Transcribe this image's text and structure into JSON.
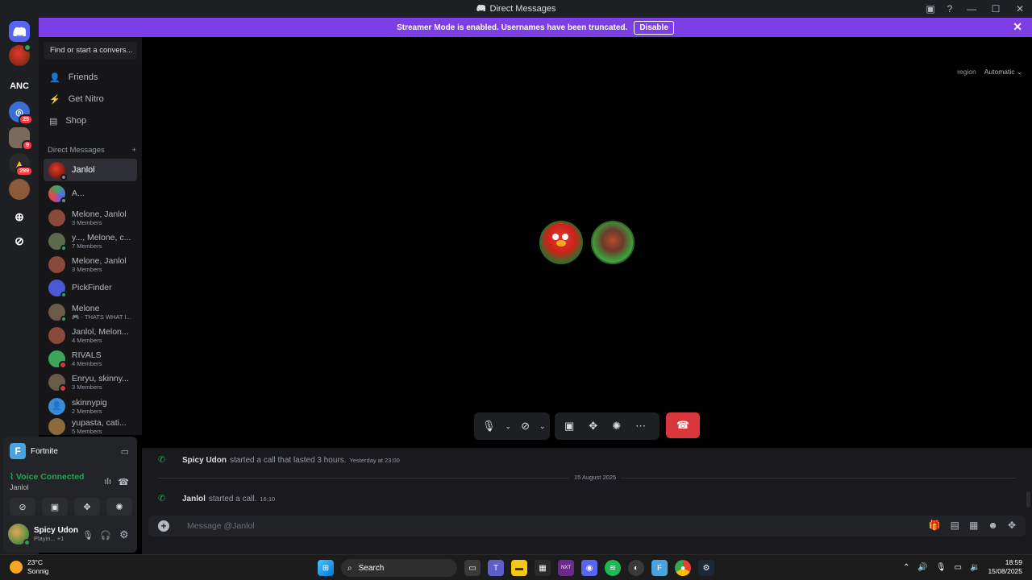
{
  "window": {
    "title": "Direct Messages"
  },
  "banner": {
    "text": "Streamer Mode is enabled. Usernames have been truncated.",
    "button": "Disable"
  },
  "servers": [
    {
      "label": "",
      "badge": ""
    },
    {
      "label": "ANC",
      "badge": ""
    },
    {
      "label": "",
      "badge": "25"
    },
    {
      "label": "",
      "badge": "9"
    },
    {
      "label": "",
      "badge": "299"
    }
  ],
  "sidebar": {
    "search_placeholder": "Find or start a convers...",
    "nav": [
      "Friends",
      "Get Nitro",
      "Shop"
    ],
    "dm_header": "Direct Messages",
    "dms": [
      {
        "name": "Janlol",
        "sub": ""
      },
      {
        "name": "A...",
        "sub": ""
      },
      {
        "name": "Melone, Janlol",
        "sub": "3 Members"
      },
      {
        "name": "y..., Melone, c...",
        "sub": "7 Members"
      },
      {
        "name": "Melone, Janlol",
        "sub": "3 Members"
      },
      {
        "name": "PickFinder",
        "sub": ""
      },
      {
        "name": "Melone",
        "sub": "🎮 - THATS WHAT I..."
      },
      {
        "name": "Janlol, Melon...",
        "sub": "4 Members"
      },
      {
        "name": "RIVALS",
        "sub": "4 Members"
      },
      {
        "name": "Enryu, skinny...",
        "sub": "3 Members"
      },
      {
        "name": "skinnypig",
        "sub": "2 Members"
      },
      {
        "name": "yupasta, cati...",
        "sub": "5 Members"
      }
    ]
  },
  "panel": {
    "game": "Fortnite",
    "voice_status": "Voice Connected",
    "channel": "Janlol",
    "user_name": "Spicy Udon",
    "user_status": "Playin...",
    "user_extra": "+1"
  },
  "call": {
    "region_label": "region",
    "region_value": "Automatic"
  },
  "chat": {
    "messages": [
      {
        "who": "Spicy Udon",
        "text": "started a call that lasted 3 hours.",
        "time": "Yesterday at 23:00"
      },
      {
        "who": "Janlol",
        "text": "started a call.",
        "time": "16:10"
      }
    ],
    "date_divider": "15 August 2025",
    "input_placeholder": "Message @Janlol"
  },
  "taskbar": {
    "temp": "23°C",
    "weather": "Sonnig",
    "search": "Search",
    "time": "18:59",
    "date": "15/08/2025"
  },
  "colors": {
    "accent": "#5865f2",
    "streamer_banner": "#7e3ee6",
    "online": "#23a55a",
    "hangup": "#da373c"
  }
}
